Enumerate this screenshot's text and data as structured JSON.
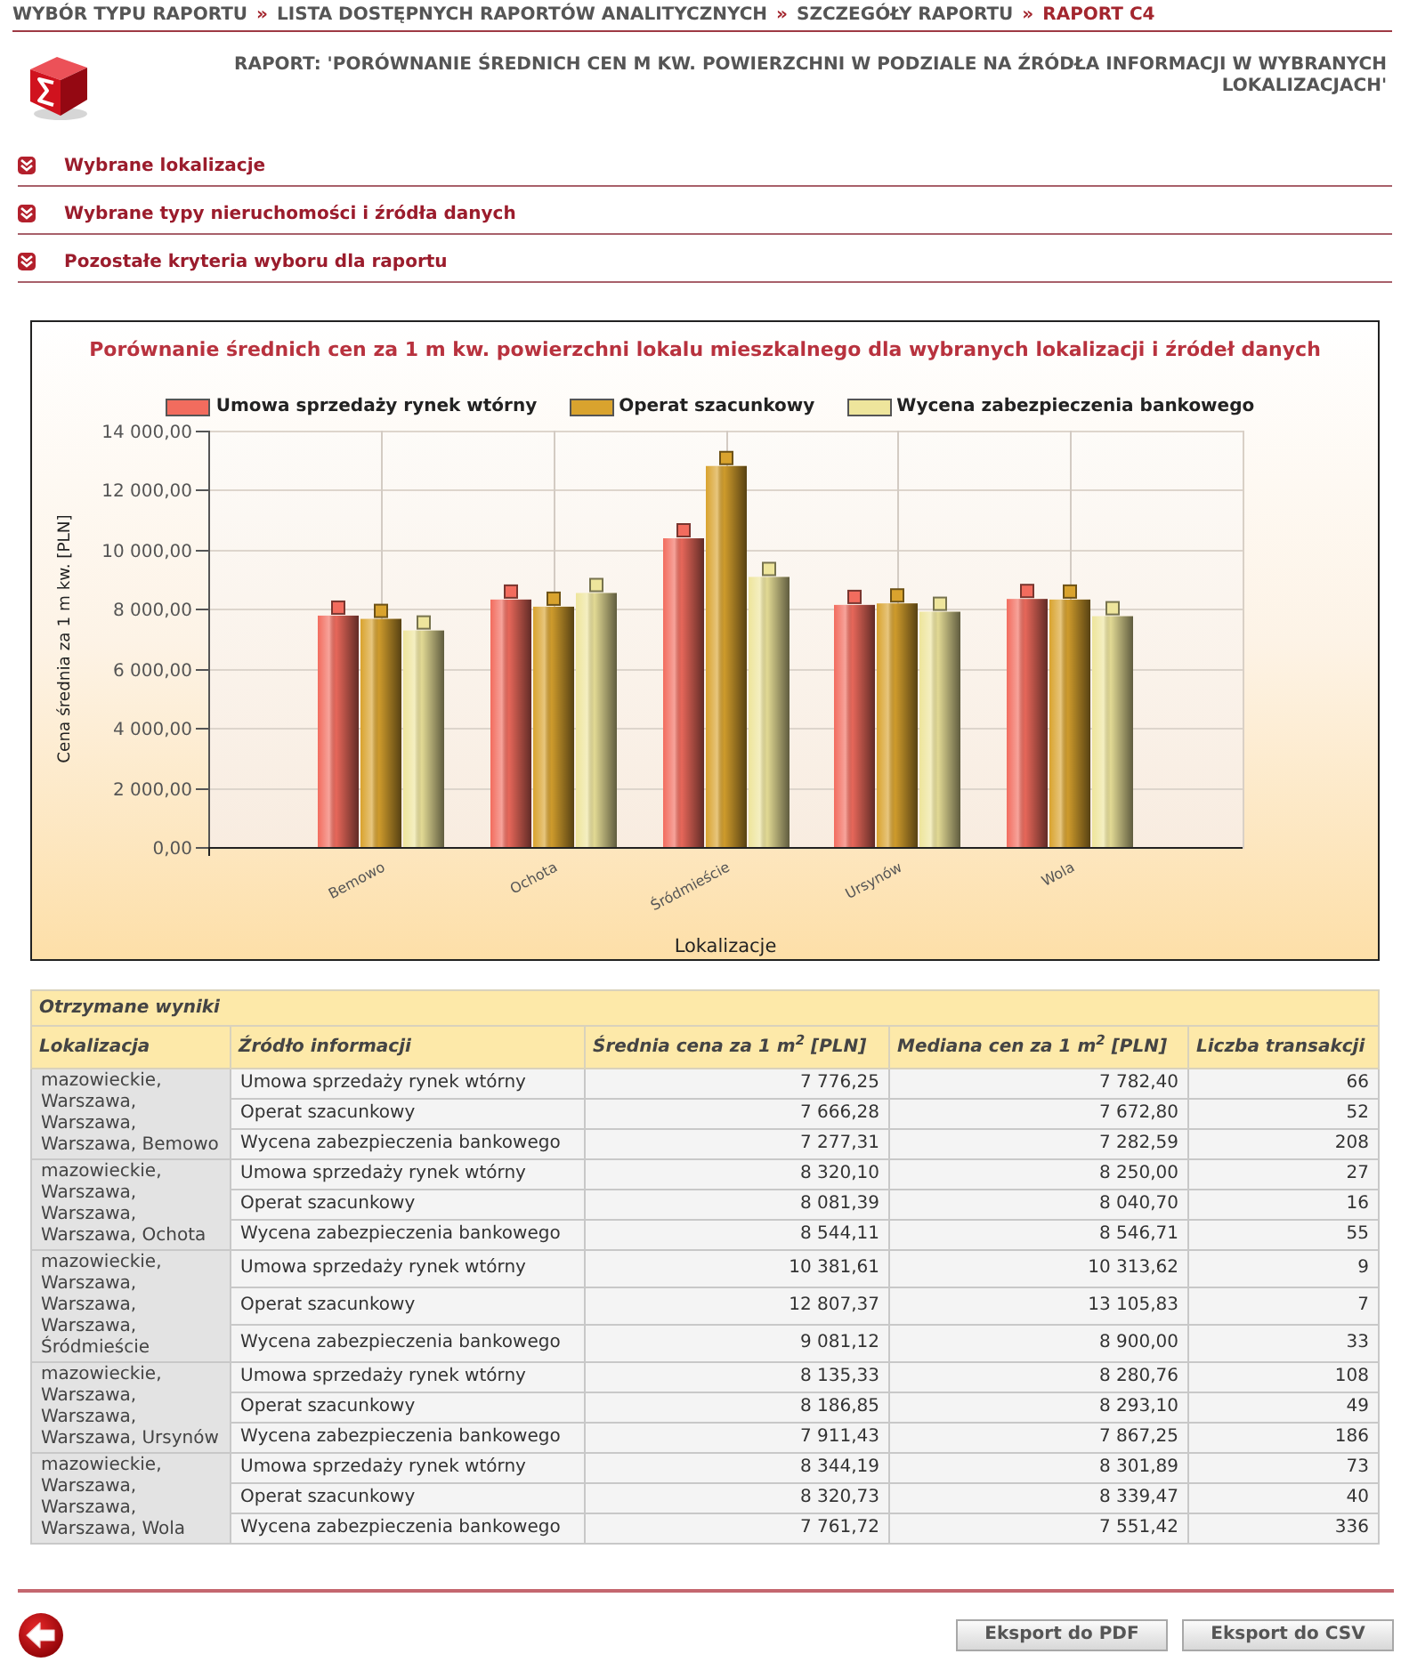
{
  "breadcrumb": {
    "items": [
      {
        "label": "WYBÓR TYPU RAPORTU",
        "selected": false
      },
      {
        "label": "LISTA DOSTĘPNYCH RAPORTÓW ANALITYCZNYCH",
        "selected": false
      },
      {
        "label": "SZCZEGÓŁY RAPORTU",
        "selected": false
      },
      {
        "label": "RAPORT C4",
        "selected": true
      }
    ],
    "separators": [
      "»",
      "»",
      "»"
    ]
  },
  "report": {
    "title": "RAPORT: 'PORÓWNANIE ŚREDNICH CEN M KW. POWIERZCHNI W PODZIALE NA ŹRÓDŁA INFORMACJI W WYBRANYCH LOKALIZACJACH'"
  },
  "sections": [
    {
      "label": "Wybrane lokalizacje",
      "expanded": false
    },
    {
      "label": "Wybrane typy nieruchomości i źródła danych",
      "expanded": false
    },
    {
      "label": "Pozostałe kryteria wyboru dla raportu",
      "expanded": false
    }
  ],
  "chart": {
    "chart_data": {
      "type": "bar",
      "title": "Porównanie średnich cen za 1 m kw. powierzchni lokalu mieszkalnego dla wybranych lokalizacji i źródeł danych",
      "xlabel": "Lokalizacje",
      "ylabel": "Cena średnia za 1 m kw. [PLN]",
      "legend": "top",
      "grid": true,
      "categories": [
        "Bemowo",
        "Ochota",
        "Śródmieście",
        "Ursynów",
        "Wola"
      ],
      "series": [
        {
          "name": "Umowa sprzedaży rynek wtórny",
          "color": "#f26c5e",
          "values": [
            7780,
            8320,
            10380,
            8140,
            8340
          ]
        },
        {
          "name": "Operat szacunkowy",
          "color": "#d9a32e",
          "values": [
            7670,
            8080,
            12810,
            8190,
            8320
          ]
        },
        {
          "name": "Wycena zabezpieczenia bankowego",
          "color": "#eee59c",
          "values": [
            7280,
            8540,
            9080,
            7910,
            7760
          ]
        }
      ],
      "ylim": [
        0,
        14000
      ],
      "yticks": [
        {
          "value": 0,
          "label": "0,00"
        },
        {
          "value": 2000,
          "label": "2 000,00"
        },
        {
          "value": 4000,
          "label": "4 000,00"
        },
        {
          "value": 6000,
          "label": "6 000,00"
        },
        {
          "value": 8000,
          "label": "8 000,00"
        },
        {
          "value": 10000,
          "label": "10 000,00"
        },
        {
          "value": 12000,
          "label": "12 000,00"
        },
        {
          "value": 14000,
          "label": "14 000,00"
        }
      ]
    }
  },
  "results": {
    "caption": "Otrzymane wyniki",
    "columns": [
      "Lokalizacja",
      "Źródło informacji",
      "Średnia cena za 1 m$^{2}$ [PLN]",
      "Mediana cen za 1 m$^{2}$ [PLN]",
      "Liczba transakcji"
    ],
    "groups": [
      {
        "location": "mazowieckie, Warszawa, Warszawa, Warszawa, Bemowo",
        "rows": [
          {
            "cells": [
              "Umowa sprzedaży rynek wtórny",
              "7 776,25",
              "7 782,40",
              "66"
            ]
          },
          {
            "cells": [
              "Operat szacunkowy",
              "7 666,28",
              "7 672,80",
              "52"
            ]
          },
          {
            "cells": [
              "Wycena zabezpieczenia bankowego",
              "7 277,31",
              "7 282,59",
              "208"
            ]
          }
        ]
      },
      {
        "location": "mazowieckie, Warszawa, Warszawa, Warszawa, Ochota",
        "rows": [
          {
            "cells": [
              "Umowa sprzedaży rynek wtórny",
              "8 320,10",
              "8 250,00",
              "27"
            ]
          },
          {
            "cells": [
              "Operat szacunkowy",
              "8 081,39",
              "8 040,70",
              "16"
            ]
          },
          {
            "cells": [
              "Wycena zabezpieczenia bankowego",
              "8 544,11",
              "8 546,71",
              "55"
            ]
          }
        ]
      },
      {
        "location": "mazowieckie, Warszawa, Warszawa, Warszawa, Śródmieście",
        "rows": [
          {
            "cells": [
              "Umowa sprzedaży rynek wtórny",
              "10 381,61",
              "10 313,62",
              "9"
            ]
          },
          {
            "cells": [
              "Operat szacunkowy",
              "12 807,37",
              "13 105,83",
              "7"
            ]
          },
          {
            "cells": [
              "Wycena zabezpieczenia bankowego",
              "9 081,12",
              "8 900,00",
              "33"
            ]
          }
        ]
      },
      {
        "location": "mazowieckie, Warszawa, Warszawa, Warszawa, Ursynów",
        "rows": [
          {
            "cells": [
              "Umowa sprzedaży rynek wtórny",
              "8 135,33",
              "8 280,76",
              "108"
            ]
          },
          {
            "cells": [
              "Operat szacunkowy",
              "8 186,85",
              "8 293,10",
              "49"
            ]
          },
          {
            "cells": [
              "Wycena zabezpieczenia bankowego",
              "7 911,43",
              "7 867,25",
              "186"
            ]
          }
        ]
      },
      {
        "location": "mazowieckie, Warszawa, Warszawa, Warszawa, Wola",
        "rows": [
          {
            "cells": [
              "Umowa sprzedaży rynek wtórny",
              "8 344,19",
              "8 301,89",
              "73"
            ]
          },
          {
            "cells": [
              "Operat szacunkowy",
              "8 320,73",
              "8 339,47",
              "40"
            ]
          },
          {
            "cells": [
              "Wycena zabezpieczenia bankowego",
              "7 761,72",
              "7 551,42",
              "336"
            ]
          }
        ]
      }
    ]
  },
  "footer": {
    "buttons": [
      "Eksport do PDF",
      "Eksport do CSV"
    ]
  }
}
